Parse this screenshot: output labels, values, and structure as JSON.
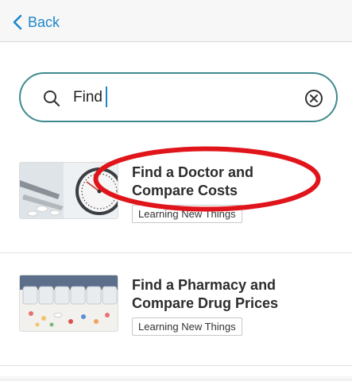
{
  "nav": {
    "back_label": "Back",
    "back_icon": "chevron-left-icon"
  },
  "search": {
    "value": "Find",
    "icon": "search-icon",
    "clear_icon": "clear-circle-icon"
  },
  "results": [
    {
      "title_line1": "Find a Doctor and",
      "title_line2": "Compare Costs",
      "tag": "Learning New Things"
    },
    {
      "title_line1": "Find a Pharmacy and",
      "title_line2": "Compare Drug Prices",
      "tag": "Learning New Things"
    }
  ],
  "colors": {
    "accent": "#1f86c9",
    "search_border": "#3f8a8f",
    "annotation": "#e0151b"
  }
}
